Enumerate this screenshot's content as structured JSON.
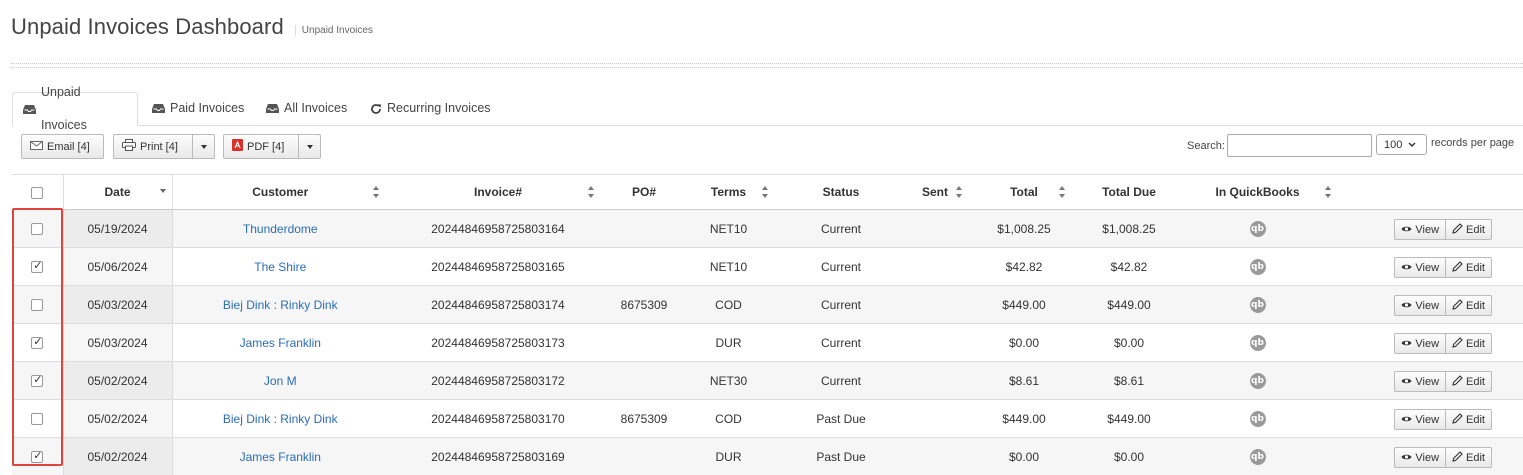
{
  "page": {
    "title": "Unpaid Invoices Dashboard",
    "subtitle": "Unpaid Invoices"
  },
  "tabs": [
    {
      "label": "Unpaid Invoices",
      "icon": "inbox-icon",
      "active": true
    },
    {
      "label": "Paid Invoices",
      "icon": "inbox-icon",
      "active": false
    },
    {
      "label": "All Invoices",
      "icon": "inbox-icon",
      "active": false
    },
    {
      "label": "Recurring Invoices",
      "icon": "refresh-icon",
      "active": false
    }
  ],
  "toolbar": {
    "email_label": "Email [4]",
    "print_label": "Print [4]",
    "pdf_label": "PDF [4]",
    "search_label": "Search:",
    "search_value": "",
    "per_page_value": "100",
    "per_page_label": "records per page"
  },
  "table": {
    "columns": [
      "Date",
      "Customer",
      "Invoice#",
      "PO#",
      "Terms",
      "Status",
      "Sent",
      "Total",
      "Total Due",
      "In QuickBooks"
    ],
    "rows": [
      {
        "checked": false,
        "date": "05/19/2024",
        "customer": "Thunderdome",
        "invoice": "20244846958725803164",
        "po": "",
        "terms": "NET10",
        "status": "Current",
        "sent": "",
        "total": "$1,008.25",
        "total_due": "$1,008.25"
      },
      {
        "checked": true,
        "date": "05/06/2024",
        "customer": "The Shire",
        "invoice": "20244846958725803165",
        "po": "",
        "terms": "NET10",
        "status": "Current",
        "sent": "",
        "total": "$42.82",
        "total_due": "$42.82"
      },
      {
        "checked": false,
        "date": "05/03/2024",
        "customer": "Biej Dink : Rinky Dink",
        "invoice": "20244846958725803174",
        "po": "8675309",
        "terms": "COD",
        "status": "Current",
        "sent": "",
        "total": "$449.00",
        "total_due": "$449.00"
      },
      {
        "checked": true,
        "date": "05/03/2024",
        "customer": "James Franklin",
        "invoice": "20244846958725803173",
        "po": "",
        "terms": "DUR",
        "status": "Current",
        "sent": "",
        "total": "$0.00",
        "total_due": "$0.00"
      },
      {
        "checked": true,
        "date": "05/02/2024",
        "customer": "Jon M",
        "invoice": "20244846958725803172",
        "po": "",
        "terms": "NET30",
        "status": "Current",
        "sent": "",
        "total": "$8.61",
        "total_due": "$8.61"
      },
      {
        "checked": false,
        "date": "05/02/2024",
        "customer": "Biej Dink : Rinky Dink",
        "invoice": "20244846958725803170",
        "po": "8675309",
        "terms": "COD",
        "status": "Past Due",
        "sent": "",
        "total": "$449.00",
        "total_due": "$449.00"
      },
      {
        "checked": true,
        "date": "05/02/2024",
        "customer": "James Franklin",
        "invoice": "20244846958725803169",
        "po": "",
        "terms": "DUR",
        "status": "Past Due",
        "sent": "",
        "total": "$0.00",
        "total_due": "$0.00"
      }
    ],
    "view_label": "View",
    "edit_label": "Edit",
    "qb_glyph": "qb"
  },
  "colors": {
    "link": "#2a6db5",
    "highlight": "#e0443e"
  }
}
